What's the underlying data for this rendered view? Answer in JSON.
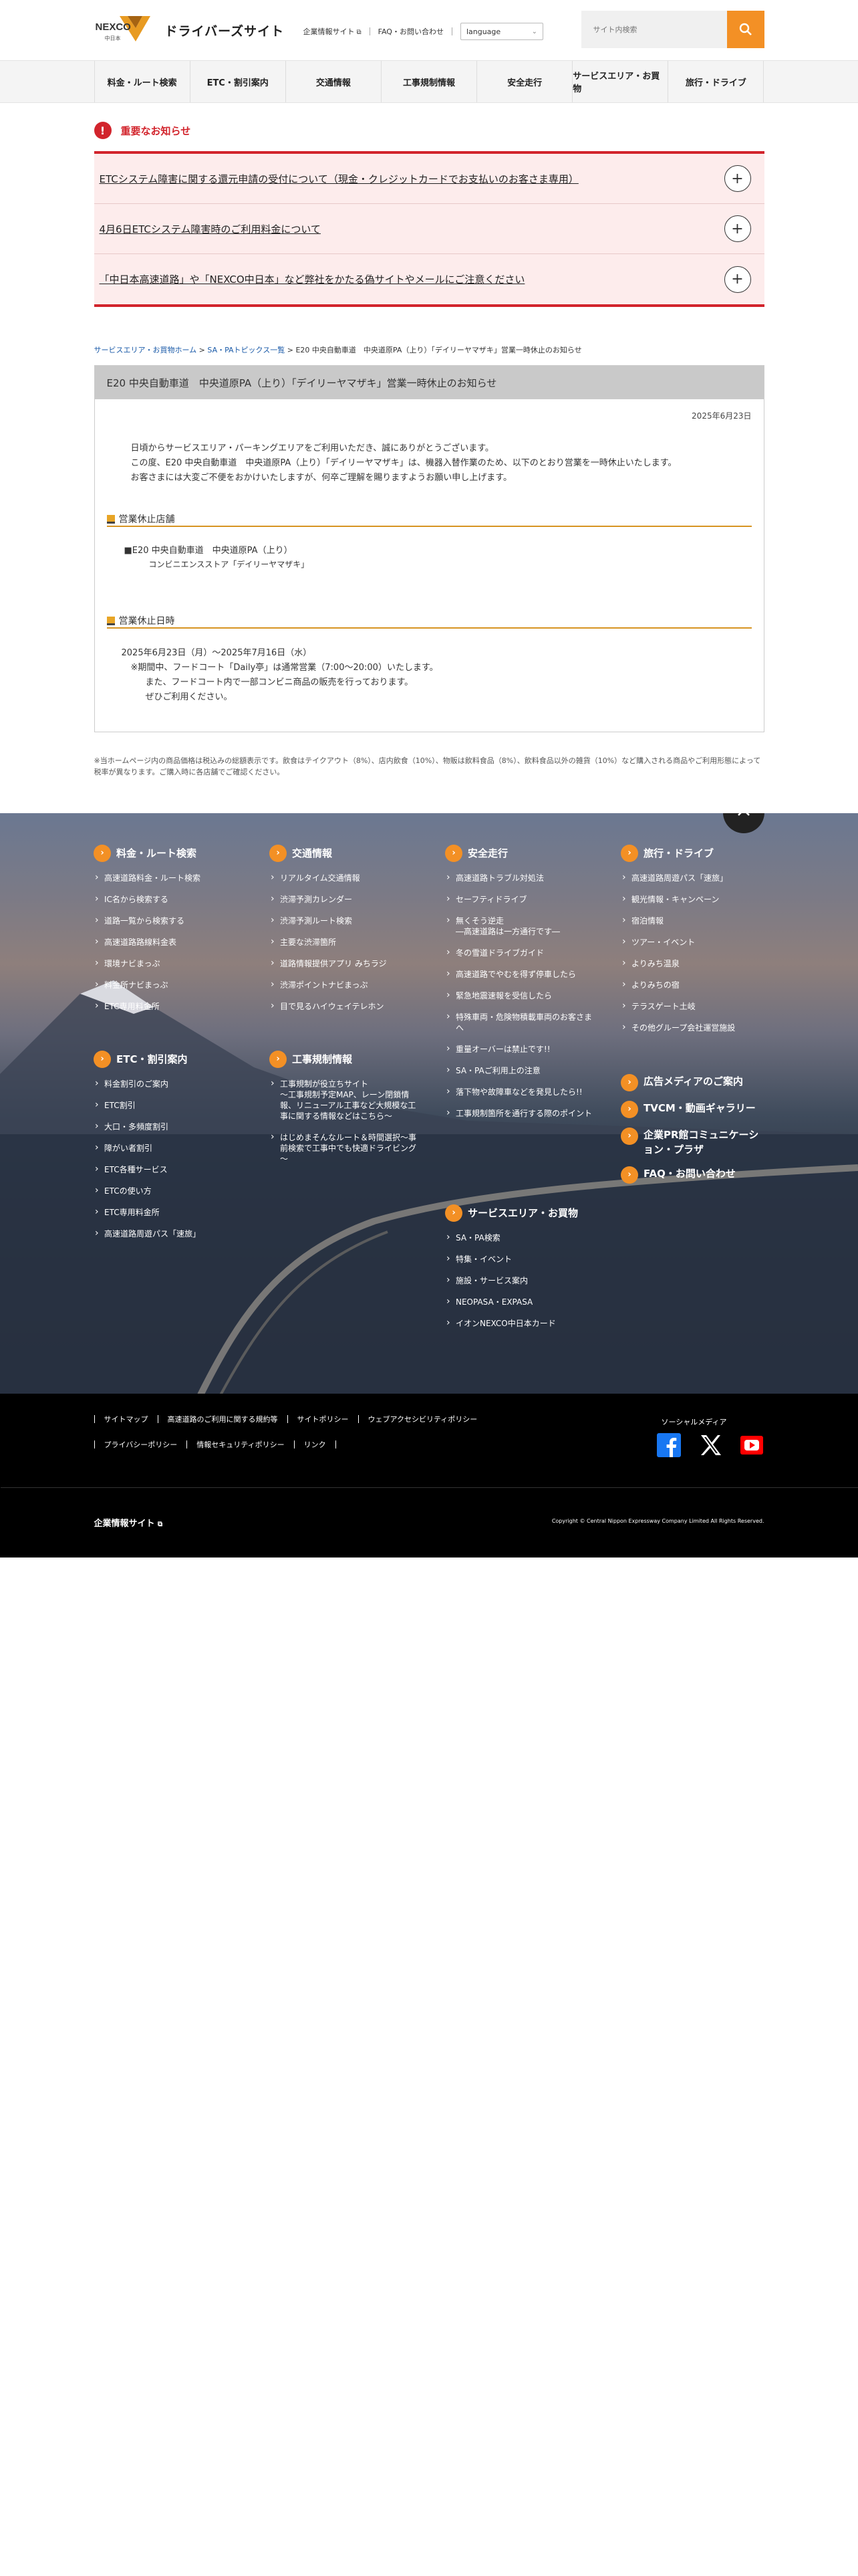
{
  "header": {
    "logo_brand": "NEXCO",
    "logo_sub": "中日本",
    "site_title": "ドライバーズサイト",
    "corp_site": "企業情報サイト",
    "faq": "FAQ・お問い合わせ",
    "language": "language",
    "search_placeholder": "サイト内検索"
  },
  "nav": [
    "料金・ルート検索",
    "ETC・割引案内",
    "交通情報",
    "工事規制情報",
    "安全走行",
    "サービスエリア・お買物",
    "旅行・ドライブ"
  ],
  "notice": {
    "title": "重要なお知らせ",
    "items": [
      "ETCシステム障害に関する還元申請の受付について（現金・クレジットカードでお支払いのお客さま専用）",
      "4月6日ETCシステム障害時のご利用料金について",
      "「中日本高速道路」や「NEXCO中日本」など弊社をかたる偽サイトやメールにご注意ください"
    ]
  },
  "breadcrumb": {
    "home": "サービスエリア・お買物ホーム",
    "sep1": ">",
    "topics": "SA・PAトピックス一覧",
    "sep2": ">",
    "current": "E20 中央自動車道　中央道原PA（上り）「デイリーヤマザキ」営業一時休止のお知らせ"
  },
  "article": {
    "title": "E20 中央自動車道　中央道原PA（上り）「デイリーヤマザキ」営業一時休止のお知らせ",
    "date": "2025年6月23日",
    "intro": [
      "日頃からサービスエリア・パーキングエリアをご利用いただき、誠にありがとうございます。",
      "この度、E20 中央自動車道　中央道原PA（上り）「デイリーヤマザキ」は、機器入替作業のため、以下のとおり営業を一時休止いたします。",
      "お客さまには大変ご不便をおかけいたしますが、何卒ご理解を賜りますようお願い申し上げます。"
    ],
    "sec1_title": "営業休止店舗",
    "shop_line": "■E20 中央自動車道　中央道原PA（上り）",
    "shop_sub": "コンビニエンスストア「デイリーヤマザキ」",
    "sec2_title": "営業休止日時",
    "period": "2025年6月23日（月）～2025年7月16日（水）",
    "period_note1": "※期間中、フードコート「Daily亭」は通常営業（7:00～20:00）いたします。",
    "period_note2": "また、フードコート内で一部コンビニ商品の販売を行っております。",
    "period_note3": "ぜひご利用ください。"
  },
  "footnote": "※当ホームページ内の商品価格は税込みの総額表示です。飲食はテイクアウト（8%）、店内飲食（10%）、物販は飲料食品（8%）、飲料食品以外の雑貨（10%）など購入される商品やご利用形態によって税率が異なります。ご購入時に各店舗でご確認ください。",
  "footer": {
    "col1": {
      "head": "料金・ルート検索",
      "items": [
        "高速道路料金・ルート検索",
        "IC名から検索する",
        "道路一覧から検索する",
        "高速道路路線料金表",
        "環境ナビまっぷ",
        "料金所ナビまっぷ",
        "ETC専用料金所"
      ]
    },
    "col2": {
      "head": "交通情報",
      "items": [
        "リアルタイム交通情報",
        "渋滞予測カレンダー",
        "渋滞予測ルート検索",
        "主要な渋滞箇所",
        "道路情報提供アプリ みちラジ",
        "渋滞ポイントナビまっぷ",
        "目で見るハイウェイテレホン"
      ]
    },
    "col3": {
      "head": "安全走行",
      "items": [
        "高速道路トラブル対処法",
        "セーフティドライブ",
        "無くそう逆走\n―高速道路は一方通行です―",
        "冬の雪道ドライブガイド",
        "高速道路でやむを得ず停車したら",
        "緊急地震速報を受信したら",
        "特殊車両・危険物積載車両のお客さまへ",
        "重量オーバーは禁止です!!",
        "SA・PAご利用上の注意",
        "落下物や故障車などを発見したら!!",
        "工事規制箇所を通行する際のポイント"
      ]
    },
    "col4": {
      "head": "旅行・ドライブ",
      "items": [
        "高速道路周遊パス「速旅」",
        "観光情報・キャンペーン",
        "宿泊情報",
        "ツアー・イベント",
        "よりみち温泉",
        "よりみちの宿",
        "テラスゲート土岐",
        "その他グループ会社運営施設"
      ]
    },
    "col5": {
      "head": "ETC・割引案内",
      "items": [
        "料金割引のご案内",
        "ETC割引",
        "大口・多頻度割引",
        "障がい者割引",
        "ETC各種サービス",
        "ETCの使い方",
        "ETC専用料金所",
        "高速道路周遊パス「速旅」"
      ]
    },
    "col6": {
      "head": "工事規制情報",
      "items": [
        "工事規制が役立ちサイト\n～工事規制予定MAP、レーン閉鎖情報、リニューアル工事など大規模な工事に関する情報などはこちら～",
        "はじめまそんなルート＆時間選択～事前検索で工事中でも快適ドライビング～"
      ]
    },
    "col7": {
      "head": "サービスエリア・お買物",
      "items": [
        "SA・PA検索",
        "特集・イベント",
        "施設・サービス案内",
        "NEOPASA・EXPASA",
        "イオンNEXCO中日本カード"
      ]
    },
    "extra": [
      "広告メディアのご案内",
      "TVCM・動画ギャラリー",
      "企業PR館コミュニケーション・プラザ",
      "FAQ・お問い合わせ"
    ],
    "legal_row1": [
      "サイトマップ",
      "高速道路のご利用に関する規約等",
      "サイトポリシー",
      "ウェブアクセシビリティポリシー"
    ],
    "legal_row2": [
      "プライバシーポリシー",
      "情報セキュリティポリシー",
      "リンク"
    ],
    "social_title": "ソーシャルメディア",
    "corp_site": "企業情報サイト",
    "copyright": "Copyright © Central Nippon Expressway Company Limited All Rights Reserved."
  },
  "colors": {
    "accent_orange": "#f39025",
    "notice_red": "#d2242c",
    "notice_bg": "#fdecec",
    "gold_rule": "#d79422"
  },
  "icons": [
    "search-icon",
    "external-link-icon",
    "chevron-down-icon",
    "info-icon",
    "plus-icon",
    "arrow-up-icon",
    "facebook-icon",
    "x-icon",
    "youtube-icon"
  ]
}
